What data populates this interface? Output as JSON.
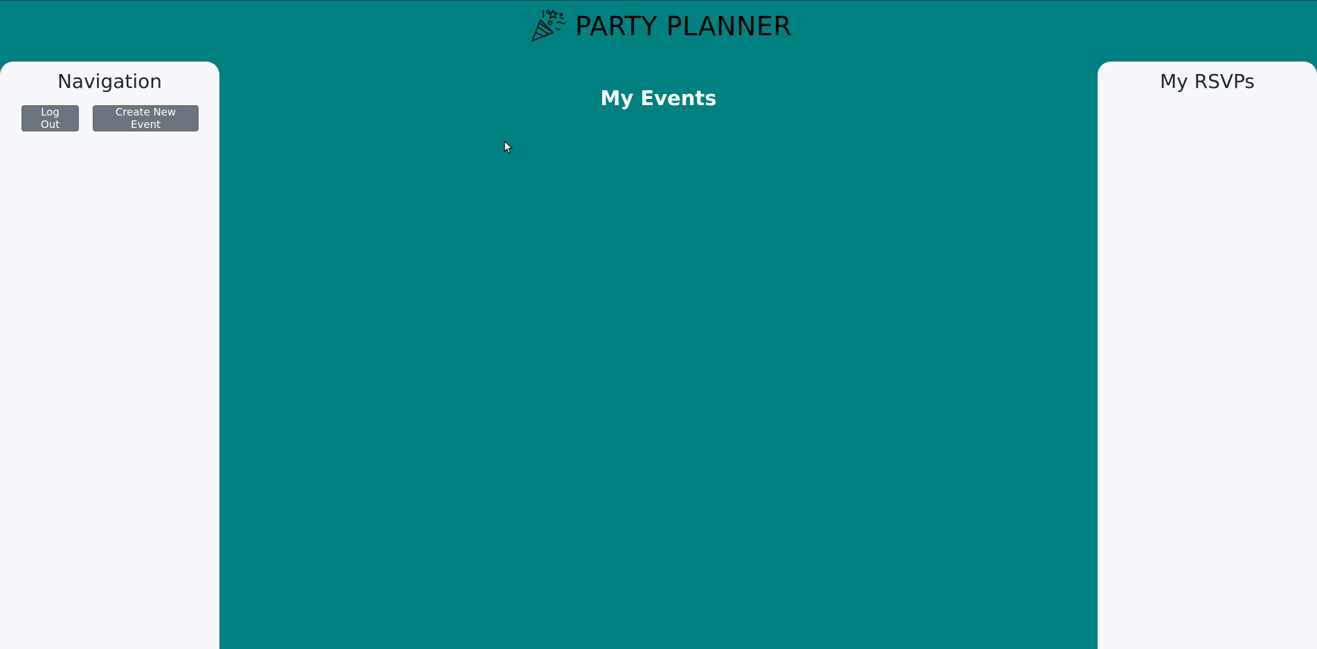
{
  "header": {
    "title": "PARTY PLANNER",
    "logo_icon": "party-popper-icon"
  },
  "navigation": {
    "title": "Navigation",
    "buttons": [
      {
        "label": "Log Out"
      },
      {
        "label": "Create New Event"
      }
    ]
  },
  "main": {
    "title": "My Events",
    "events": []
  },
  "rsvps": {
    "title": "My RSVPs",
    "items": []
  },
  "colors": {
    "background": "#008080",
    "panel": "#f7f8fb",
    "button": "#6c757d",
    "button_text": "#ffffff",
    "main_title": "#ffffff"
  }
}
